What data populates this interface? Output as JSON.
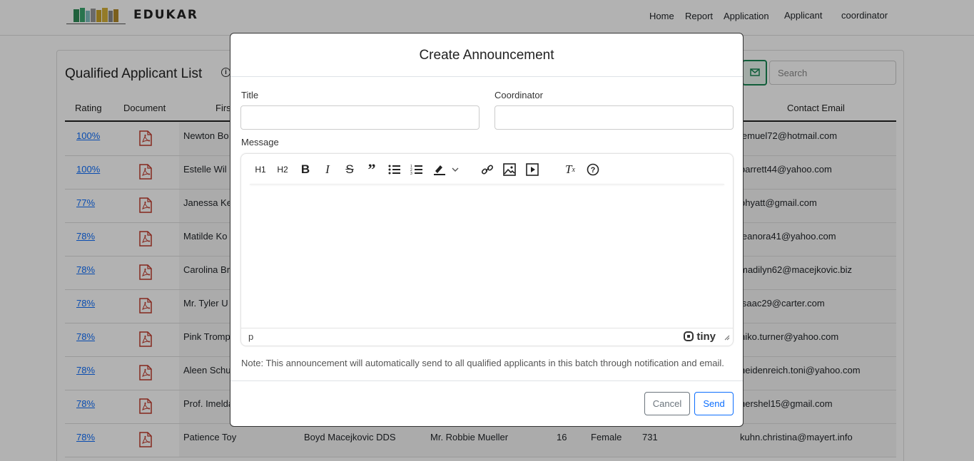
{
  "brand": "EDUKAR",
  "nav": [
    "Home",
    "Report",
    "Application",
    "Applicant",
    "coordinator"
  ],
  "page": {
    "title": "Qualified Applicant List",
    "search_placeholder": "Search",
    "columns": [
      "Rating",
      "Document",
      "Firs",
      "Contact Email"
    ],
    "rows": [
      {
        "rating": "100%",
        "first": "Newton Bo",
        "email": "lemuel72@hotmail.com"
      },
      {
        "rating": "100%",
        "first": "Estelle Wil",
        "email": "barrett44@yahoo.com"
      },
      {
        "rating": "77%",
        "first": "Janessa Ke",
        "email": "ohyatt@gmail.com"
      },
      {
        "rating": "78%",
        "first": "Matilde Ko",
        "email": "leanora41@yahoo.com"
      },
      {
        "rating": "78%",
        "first": "Carolina Br",
        "email": "madilyn62@macejkovic.biz"
      },
      {
        "rating": "78%",
        "first": "Mr. Tyler U",
        "email": "isaac29@carter.com"
      },
      {
        "rating": "78%",
        "first": "Pink Tromp",
        "email": "niko.turner@yahoo.com"
      },
      {
        "rating": "78%",
        "first": "Aleen Schu",
        "email": "heidenreich.toni@yahoo.com"
      },
      {
        "rating": "78%",
        "first": "Prof. Imelda",
        "email": "hershel15@gmail.com"
      },
      {
        "rating": "78%",
        "first": "Patience Toy",
        "middle": "Boyd Macejkovic DDS",
        "last": "Mr. Robbie Mueller",
        "age": "16",
        "gender": "Female",
        "code": "731",
        "email": "kuhn.christina@mayert.info"
      }
    ]
  },
  "modal": {
    "title": "Create Announcement",
    "title_label": "Title",
    "coordinator_label": "Coordinator",
    "message_label": "Message",
    "toolbar": {
      "h1": "H1",
      "h2": "H2"
    },
    "status_path": "p",
    "tiny_brand": "tiny",
    "note": "Note: This announcement will automatically send to all qualified applicants in this batch through notification and email.",
    "cancel": "Cancel",
    "send": "Send"
  }
}
